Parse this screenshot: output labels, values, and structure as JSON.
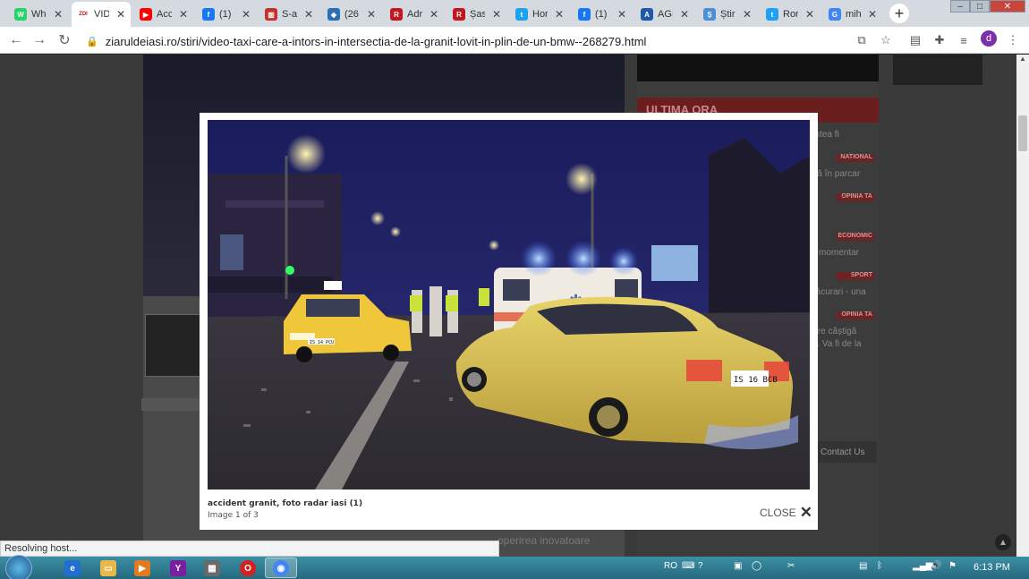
{
  "browser": {
    "tabs": [
      {
        "label": "WhatsApp",
        "icon": "whatsapp-icon",
        "color": "#25d366",
        "glyph": "W"
      },
      {
        "label": "VIDEO",
        "icon": "zdi-icon",
        "color": "#ffffff",
        "glyph": "ZDI",
        "active": true
      },
      {
        "label": "Acc",
        "icon": "youtube-icon",
        "color": "#ff0000",
        "glyph": "▶"
      },
      {
        "label": "(1)",
        "icon": "facebook-icon",
        "color": "#1877f2",
        "glyph": "f"
      },
      {
        "label": "S-a",
        "icon": "chart-icon",
        "color": "#c4302b",
        "glyph": "▥"
      },
      {
        "label": "(26",
        "icon": "chat-icon",
        "color": "#2a6fb5",
        "glyph": "◆"
      },
      {
        "label": "Adr",
        "icon": "r-icon",
        "color": "#c4161c",
        "glyph": "R"
      },
      {
        "label": "Șas",
        "icon": "r-icon",
        "color": "#c4161c",
        "glyph": "R"
      },
      {
        "label": "Hor",
        "icon": "twitter-icon",
        "color": "#1da1f2",
        "glyph": "t"
      },
      {
        "label": "(1)",
        "icon": "facebook-icon",
        "color": "#1877f2",
        "glyph": "f"
      },
      {
        "label": "AGI",
        "icon": "agi-icon",
        "color": "#1f5aa8",
        "glyph": "A"
      },
      {
        "label": "Știri",
        "icon": "news-icon",
        "color": "#4a90d9",
        "glyph": "Ș"
      },
      {
        "label": "Ror",
        "icon": "twitter-icon",
        "color": "#1da1f2",
        "glyph": "t"
      },
      {
        "label": "mih",
        "icon": "google-icon",
        "color": "#4285f4",
        "glyph": "G"
      }
    ],
    "url": "ziaruldeiasi.ro/stiri/video-taxi-care-a-intors-in-intersectia-de-la-granit-lovit-in-plin-de-un-bmw--268279.html",
    "profile_initial": "d"
  },
  "page": {
    "sidebar_heading": "ULTIMA ORA",
    "sidebar_items": [
      "putea fi",
      "ată în parcar",
      "și momentar",
      "Păcurari - una",
      "rare câștigă",
      "rs. Va fi de la"
    ],
    "sidebar_badges": [
      "NATIONAL",
      "OPINIA TA",
      "ECONOMIC",
      "SPORT",
      "OPINIA TA"
    ],
    "contact_label": "Contact Us",
    "bottom_text": "operirea inovatoare"
  },
  "lightbox": {
    "caption": "accident granit, foto radar iasi (1)",
    "counter": "Image 1 of 3",
    "close_label": "CLOSE",
    "photo": {
      "taxi_plate": "IS 14 PCU",
      "bmw_plate": "IS 16 BCB"
    }
  },
  "status_text": "Resolving host...",
  "taskbar": {
    "language": "RO",
    "time": "6:13 PM"
  }
}
